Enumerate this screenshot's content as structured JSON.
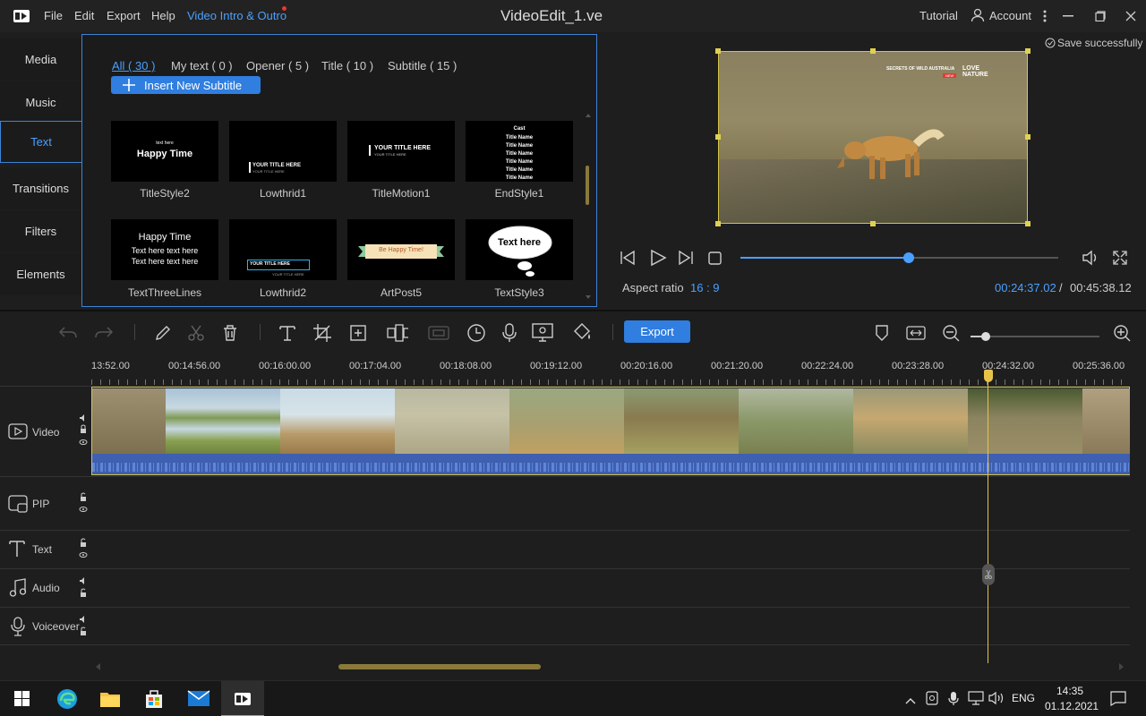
{
  "menu": {
    "file": "File",
    "edit": "Edit",
    "export": "Export",
    "help": "Help",
    "intro": "Video Intro & Outro"
  },
  "title": "VideoEdit_1.ve",
  "header_right": {
    "tutorial": "Tutorial",
    "account": "Account"
  },
  "left_tabs": [
    "Media",
    "Music",
    "Text",
    "Transitions",
    "Filters",
    "Elements"
  ],
  "library": {
    "categories": [
      "All ( 30 )",
      "My text ( 0 )",
      "Opener ( 5 )",
      "Title ( 10 )",
      "Subtitle ( 15 )"
    ],
    "insert_button": "Insert New Subtitle",
    "items": [
      {
        "name": "TitleStyle2",
        "big": "Happy Time",
        "small": "text here"
      },
      {
        "name": "Lowthrid1",
        "big": "YOUR TITLE HERE",
        "small": "YOUR TITLE HERE"
      },
      {
        "name": "TitleMotion1",
        "big": "YOUR TITLE HERE",
        "small": "YOUR TITLE HERE"
      },
      {
        "name": "EndStyle1",
        "big": "Cast",
        "small": "Title Name"
      },
      {
        "name": "TextThreeLines",
        "big": "Happy Time",
        "small": "Text here text here"
      },
      {
        "name": "Lowthrid2",
        "big": "YOUR TITLE HERE",
        "small": "YOUR TITLE HERE"
      },
      {
        "name": "ArtPost5",
        "big": "Be Happy Time!",
        "small": ""
      },
      {
        "name": "TextStyle3",
        "big": "Text here",
        "small": ""
      }
    ]
  },
  "preview": {
    "save_status": "Save successfully",
    "watermark_small": "SECRETS OF WILD AUSTRALIA",
    "watermark_logo": "LOVE NATURE",
    "watermark_tag": "NEW",
    "aspect_label": "Aspect ratio",
    "aspect_value": "16 : 9",
    "time_current": "00:24:37.02",
    "time_sep": "/",
    "time_total": "00:45:38.12",
    "progress": 0.53
  },
  "toolbar": {
    "export": "Export",
    "zoom": 0.12
  },
  "ruler": [
    "13:52.00",
    "00:14:56.00",
    "00:16:00.00",
    "00:17:04.00",
    "00:18:08.00",
    "00:19:12.00",
    "00:20:16.00",
    "00:21:20.00",
    "00:22:24.00",
    "00:23:28.00",
    "00:24:32.00",
    "00:25:36.00"
  ],
  "tracks": [
    "Video",
    "PIP",
    "Text",
    "Audio",
    "Voiceover"
  ],
  "taskbar": {
    "lang": "ENG",
    "time": "14:35",
    "date": "01.12.2021"
  },
  "colors": {
    "accent": "#2f7ee0",
    "link": "#4aa0ff",
    "playhead": "#e8c34a",
    "audio": "#3f5fb0"
  }
}
